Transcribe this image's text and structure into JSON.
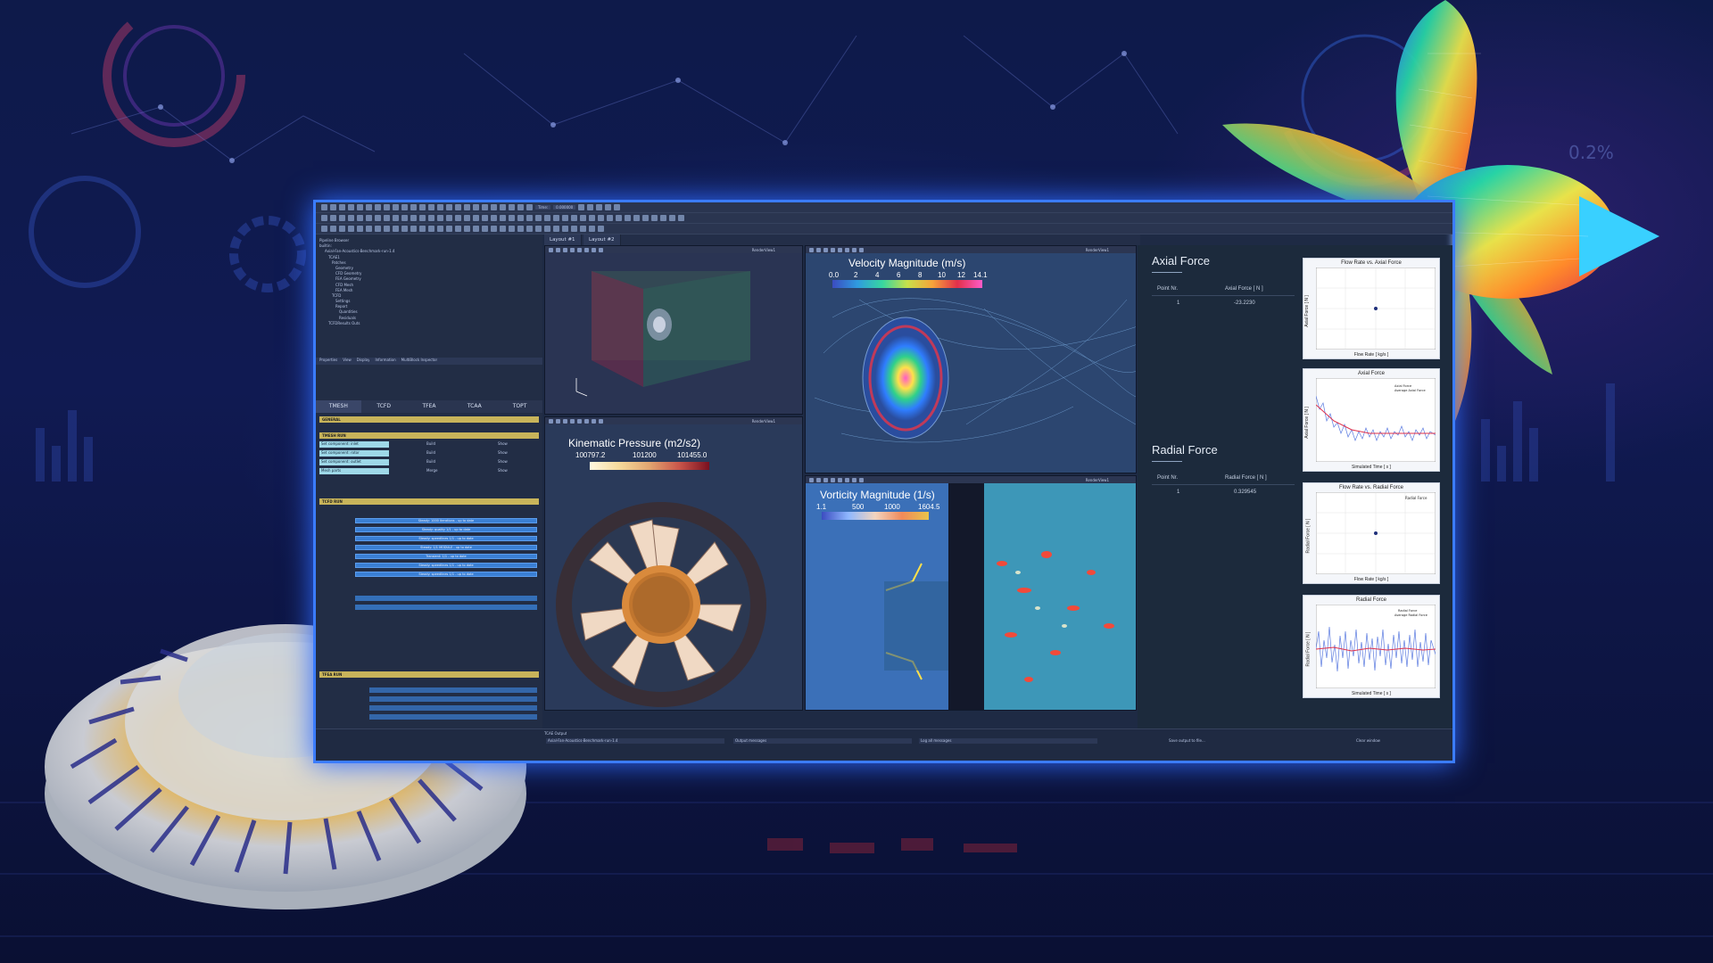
{
  "window": {
    "toolbar_time_label": "Time:",
    "toolbar_time_value": "0.000000"
  },
  "tabs": {
    "layout1": "Layout #1",
    "layout2": "Layout #2"
  },
  "pipeline": {
    "title": "Pipeline Browser",
    "root": "builtin:",
    "items": [
      "Axial-Fan-Acoustics-Benchmark-run-1.4",
      "TCAE1",
      "Patches",
      "Geometry",
      "CFD Geometry",
      "FEA Geometry",
      "CFD Mesh",
      "FEA Mesh",
      "TCFD",
      "Settings",
      "Report",
      "Quantities",
      "Residuals",
      "TCFDResults Outs"
    ]
  },
  "panel_tabs": [
    "Properties",
    "View",
    "Display",
    "Information",
    "MultiBlock Inspector"
  ],
  "module_tabs": [
    "TMESH",
    "TCFD",
    "TFEA",
    "TCAA",
    "TOPT"
  ],
  "sections": {
    "general": "GENERAL",
    "tmesh_run": "TMESH RUN",
    "tcfd_run": "TCFD RUN",
    "tfea_run": "TFEA RUN"
  },
  "tmesh_rows": [
    {
      "label": "Set component: inlet",
      "a": "Build",
      "b": "Show"
    },
    {
      "label": "Set component: rotor",
      "a": "Build",
      "b": "Show"
    },
    {
      "label": "Set component: outlet",
      "a": "Build",
      "b": "Show"
    },
    {
      "label": "Mesh parts",
      "a": "Merge",
      "b": "Show"
    }
  ],
  "tcfd_bars": [
    "Steady: 1000 iterations - up to date",
    "Steady: quality 1/1 - up to date",
    "Steady: speedlines 1/1 - up to date",
    "Steady: 1/1 MODULE - up to date",
    "Transient: 1/1 - up to date",
    "Steady: speedlines 1/1 - up to date",
    "Steady: speedlines 1/1 - up to date"
  ],
  "views": {
    "render_label": "RenderView1",
    "velocity": {
      "title": "Velocity Magnitude (m/s)",
      "ticks": [
        "0.0",
        "2",
        "4",
        "6",
        "8",
        "10",
        "12",
        "14.1"
      ]
    },
    "pressure": {
      "title": "Kinematic Pressure (m2/s2)",
      "ticks": [
        "100797.2",
        "101200",
        "101455.0"
      ]
    },
    "vorticity": {
      "title": "Vorticity Magnitude (1/s)",
      "ticks": [
        "1.1",
        "500",
        "1000",
        "1604.5"
      ]
    }
  },
  "results": {
    "axial": {
      "title": "Axial Force",
      "col1": "Point Nr.",
      "col2": "Axial Force [ N ]",
      "row_pt": "1",
      "row_val": "-23.2230"
    },
    "radial": {
      "title": "Radial Force",
      "col1": "Point Nr.",
      "col2": "Radial Force [ N ]",
      "row_pt": "1",
      "row_val": "0.329545"
    }
  },
  "output": {
    "title": "TCAE Output",
    "dropdown1": "Axial-Fan-Acoustics-Benchmark-run-1.4",
    "dropdown2": "Output messages",
    "dropdown3": "Log all messages",
    "save": "Save output to file...",
    "clear": "Clear window"
  },
  "chart_data": [
    {
      "type": "scatter",
      "title": "Flow Rate vs. Axial Force",
      "xlabel": "Flow Rate [ kg/s ]",
      "ylabel": "Axial Force [ N ]",
      "x": [
        1.675
      ],
      "y": [
        -23.2
      ],
      "legend": "Axial Force"
    },
    {
      "type": "line",
      "title": "Axial Force",
      "xlabel": "Simulated Time [ s ]",
      "ylabel": "Axial Force [ N ]",
      "series": [
        {
          "name": "Axial Force"
        },
        {
          "name": "Average Axial Force"
        }
      ]
    },
    {
      "type": "scatter",
      "title": "Flow Rate vs. Radial Force",
      "xlabel": "Flow Rate [ kg/s ]",
      "ylabel": "Radial Force [ N ]",
      "x": [
        1.675
      ],
      "y": [
        0.33
      ],
      "legend": "Radial Force"
    },
    {
      "type": "line",
      "title": "Radial Force",
      "xlabel": "Simulated Time [ s ]",
      "ylabel": "Radial Force [ N ]",
      "series": [
        {
          "name": "Radial Force"
        },
        {
          "name": "Average Radial Force"
        }
      ]
    }
  ],
  "colors": {
    "frame_glow": "#3b7cff",
    "accent": "#3a7fd4",
    "section": "#c8b45a"
  }
}
